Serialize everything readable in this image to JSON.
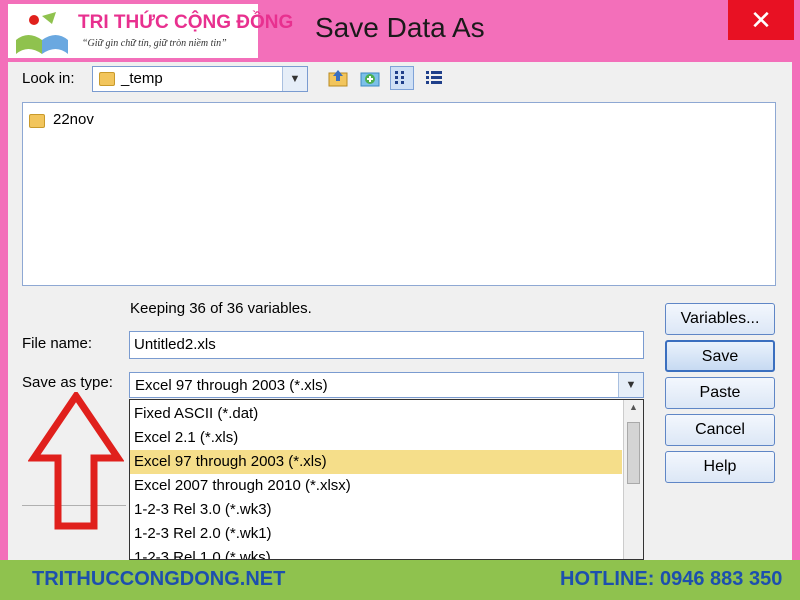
{
  "brand": {
    "name": "TRI THỨC CỘNG ĐỒNG",
    "slogan": "“Giữ gìn chữ tín, giữ tròn niềm tin”"
  },
  "dialog": {
    "title": "Save Data As",
    "close_label": "✕"
  },
  "look_in": {
    "label": "Look in:",
    "value": "_temp"
  },
  "files": [
    {
      "name": "22nov"
    }
  ],
  "info_text": "Keeping 36 of 36 variables.",
  "file_name": {
    "label": "File name:",
    "value": "Untitled2.xls"
  },
  "save_as_type": {
    "label": "Save as type:",
    "value": "Excel 97 through 2003 (*.xls)",
    "options": [
      "Fixed ASCII (*.dat)",
      "Excel 2.1 (*.xls)",
      "Excel 97 through 2003 (*.xls)",
      "Excel 2007 through 2010 (*.xlsx)",
      "1-2-3 Rel 3.0 (*.wk3)",
      "1-2-3 Rel 2.0 (*.wk1)",
      "1-2-3 Rel 1.0 (*.wks)"
    ],
    "selected_index": 2
  },
  "buttons": {
    "variables": "Variables...",
    "save": "Save",
    "paste": "Paste",
    "cancel": "Cancel",
    "help": "Help"
  },
  "footer": {
    "website": "TRITHUCCONGDONG.NET",
    "hotline": "HOTLINE: 0946 883 350"
  },
  "colors": {
    "frame": "#f36fba",
    "close": "#e81123",
    "selection": "#f5de8a",
    "arrow": "#e0201c",
    "footer": "#8fc24e",
    "footer_text": "#1d4fae"
  }
}
